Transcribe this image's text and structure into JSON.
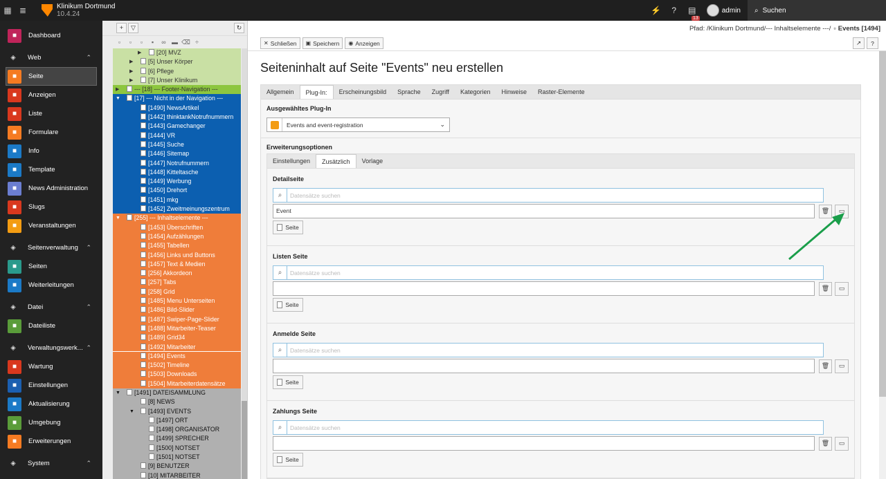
{
  "topbar": {
    "site_name": "Klinikum Dortmund",
    "version": "10.4.24",
    "badge_count": "13",
    "user": "admin",
    "search_label": "Suchen"
  },
  "modules": [
    {
      "type": "item",
      "label": "Dashboard",
      "color": "#c0245a",
      "icon": "dashboard-icon"
    },
    {
      "type": "group",
      "label": "Web",
      "icon": "file-icon"
    },
    {
      "type": "item",
      "label": "Seite",
      "color": "#f57b22",
      "icon": "page-icon",
      "active": true
    },
    {
      "type": "item",
      "label": "Anzeigen",
      "color": "#d9381e",
      "icon": "eye-icon"
    },
    {
      "type": "item",
      "label": "Liste",
      "color": "#d9381e",
      "icon": "list-icon"
    },
    {
      "type": "item",
      "label": "Formulare",
      "color": "#f57b22",
      "icon": "form-icon"
    },
    {
      "type": "item",
      "label": "Info",
      "color": "#1b7ac7",
      "icon": "info-icon"
    },
    {
      "type": "item",
      "label": "Template",
      "color": "#1b7ac7",
      "icon": "template-icon"
    },
    {
      "type": "item",
      "label": "News Administration",
      "color": "#6b7ed1",
      "icon": "news-icon"
    },
    {
      "type": "item",
      "label": "Slugs",
      "color": "#d9381e",
      "icon": "slug-icon"
    },
    {
      "type": "item",
      "label": "Veranstaltungen",
      "color": "#f39c12",
      "icon": "calendar-icon"
    },
    {
      "type": "group",
      "label": "Seitenverwaltung",
      "icon": "globe-icon"
    },
    {
      "type": "item",
      "label": "Seiten",
      "color": "#2a9a8c",
      "icon": "pages-icon"
    },
    {
      "type": "item",
      "label": "Weiterleitungen",
      "color": "#1b7ac7",
      "icon": "redirect-icon"
    },
    {
      "type": "group",
      "label": "Datei",
      "icon": "image-icon"
    },
    {
      "type": "item",
      "label": "Dateiliste",
      "color": "#5a9c3a",
      "icon": "filelist-icon"
    },
    {
      "type": "group",
      "label": "Verwaltungswerk...",
      "icon": "rocket-icon"
    },
    {
      "type": "item",
      "label": "Wartung",
      "color": "#d9381e",
      "icon": "wrench-icon"
    },
    {
      "type": "item",
      "label": "Einstellungen",
      "color": "#1b5fb0",
      "icon": "gear-icon"
    },
    {
      "type": "item",
      "label": "Aktualisierung",
      "color": "#1b7ac7",
      "icon": "refresh-icon"
    },
    {
      "type": "item",
      "label": "Umgebung",
      "color": "#5a9c3a",
      "icon": "monitor-icon"
    },
    {
      "type": "item",
      "label": "Erweiterungen",
      "color": "#f57b22",
      "icon": "box-icon"
    },
    {
      "type": "group",
      "label": "System",
      "icon": "power-icon"
    }
  ],
  "tree": [
    {
      "text": "[20] MVZ",
      "sec": "green",
      "lvl": "l2",
      "arrow": "▶"
    },
    {
      "text": "[5] Unser Körper",
      "sec": "green",
      "lvl": "l1",
      "arrow": "▶"
    },
    {
      "text": "[6] Pflege",
      "sec": "green",
      "lvl": "l1",
      "arrow": "▶"
    },
    {
      "text": "[7] Unser Klinikum",
      "sec": "green",
      "lvl": "l1",
      "arrow": "▶"
    },
    {
      "text": "--- [18] --- Footer-Navigation ---",
      "sec": "green2",
      "lvl": "l0",
      "arrow": "▶"
    },
    {
      "text": "[17] --- Nicht in der Navigation ---",
      "sec": "blue",
      "lvl": "l0",
      "arrow": "▼"
    },
    {
      "text": "[1490] NewsArtikel",
      "sec": "blue",
      "lvl": "l1"
    },
    {
      "text": "[1442] thinktankNotrufnummern",
      "sec": "blue",
      "lvl": "l1"
    },
    {
      "text": "[1443] Gamechanger",
      "sec": "blue",
      "lvl": "l1"
    },
    {
      "text": "[1444] VR",
      "sec": "blue",
      "lvl": "l1"
    },
    {
      "text": "[1445] Suche",
      "sec": "blue",
      "lvl": "l1"
    },
    {
      "text": "[1446] Sitemap",
      "sec": "blue",
      "lvl": "l1"
    },
    {
      "text": "[1447] Notrufnummern",
      "sec": "blue",
      "lvl": "l1"
    },
    {
      "text": "[1448] Kitteltasche",
      "sec": "blue",
      "lvl": "l1"
    },
    {
      "text": "[1449] Werbung",
      "sec": "blue",
      "lvl": "l1"
    },
    {
      "text": "[1450] Drehort",
      "sec": "blue",
      "lvl": "l1"
    },
    {
      "text": "[1451] mkg",
      "sec": "blue",
      "lvl": "l1"
    },
    {
      "text": "[1452] Zweitmeinungszentrum",
      "sec": "blue",
      "lvl": "l1"
    },
    {
      "text": "[255] --- Inhaltselemente ---",
      "sec": "orange",
      "lvl": "l0",
      "arrow": "▼"
    },
    {
      "text": "[1453] Überschriften",
      "sec": "orange",
      "lvl": "l1"
    },
    {
      "text": "[1454] Aufzählungen",
      "sec": "orange",
      "lvl": "l1"
    },
    {
      "text": "[1455] Tabellen",
      "sec": "orange",
      "lvl": "l1"
    },
    {
      "text": "[1456] Links und Buttons",
      "sec": "orange",
      "lvl": "l1"
    },
    {
      "text": "[1457] Text & Medien",
      "sec": "orange",
      "lvl": "l1"
    },
    {
      "text": "[256] Akkordeon",
      "sec": "orange",
      "lvl": "l1"
    },
    {
      "text": "[257] Tabs",
      "sec": "orange",
      "lvl": "l1"
    },
    {
      "text": "[258] Grid",
      "sec": "orange",
      "lvl": "l1"
    },
    {
      "text": "[1485] Menu Unterseiten",
      "sec": "orange",
      "lvl": "l1"
    },
    {
      "text": "[1486] Bild-Slider",
      "sec": "orange",
      "lvl": "l1"
    },
    {
      "text": "[1487] Swiper-Page-Slider",
      "sec": "orange",
      "lvl": "l1"
    },
    {
      "text": "[1488] Mitarbeiter-Teaser",
      "sec": "orange",
      "lvl": "l1"
    },
    {
      "text": "[1489] Grid34",
      "sec": "orange",
      "lvl": "l1"
    },
    {
      "text": "[1492] Mitarbeiter",
      "sec": "orange",
      "lvl": "l1"
    },
    {
      "text": "[1494] Events",
      "sec": "orange",
      "lvl": "l1",
      "sel": true
    },
    {
      "text": "[1502] Timeline",
      "sec": "orange",
      "lvl": "l1"
    },
    {
      "text": "[1503] Downloads",
      "sec": "orange",
      "lvl": "l1"
    },
    {
      "text": "[1504] Mitarbeiterdatensätze",
      "sec": "orange",
      "lvl": "l1"
    },
    {
      "text": "[1491] DATEISAMMLUNG",
      "sec": "gray",
      "lvl": "l0",
      "arrow": "▼"
    },
    {
      "text": "[8] NEWS",
      "sec": "gray",
      "lvl": "l1"
    },
    {
      "text": "[1493] EVENTS",
      "sec": "gray",
      "lvl": "l1",
      "arrow": "▼"
    },
    {
      "text": "[1497] ORT",
      "sec": "gray",
      "lvl": "l2"
    },
    {
      "text": "[1498] ORGANISATOR",
      "sec": "gray",
      "lvl": "l2"
    },
    {
      "text": "[1499] SPRECHER",
      "sec": "gray",
      "lvl": "l2"
    },
    {
      "text": "[1500] NOTSET",
      "sec": "gray",
      "lvl": "l2"
    },
    {
      "text": "[1501] NOTSET",
      "sec": "gray",
      "lvl": "l2"
    },
    {
      "text": "[9] BENUTZER",
      "sec": "gray",
      "lvl": "l1"
    },
    {
      "text": "[10] MITARBEITER",
      "sec": "gray",
      "lvl": "l1"
    }
  ],
  "path": {
    "prefix": "Pfad: /Klinikum Dortmund/--- Inhaltselemente ---/",
    "current": "Events [1494]"
  },
  "toolbar": {
    "close": "Schließen",
    "save": "Speichern",
    "view": "Anzeigen"
  },
  "page": {
    "title": "Seiteninhalt auf Seite \"Events\" neu erstellen",
    "tabs": [
      "Allgemein",
      "Plug-In:",
      "Erscheinungsbild",
      "Sprache",
      "Zugriff",
      "Kategorien",
      "Hinweise",
      "Raster-Elemente"
    ],
    "active_tab": 1,
    "plugin_label": "Ausgewähltes Plug-In",
    "plugin_value": "Events and event-registration",
    "ext_label": "Erweiterungsoptionen",
    "subtabs": [
      "Einstellungen",
      "Zusätzlich",
      "Vorlage"
    ],
    "active_subtab": 1,
    "search_placeholder": "Datensätze suchen",
    "page_button": "Seite",
    "fields": [
      {
        "label": "Detailseite",
        "value": "Event"
      },
      {
        "label": "Listen Seite",
        "value": ""
      },
      {
        "label": "Anmelde Seite",
        "value": ""
      },
      {
        "label": "Zahlungs Seite",
        "value": ""
      }
    ]
  }
}
